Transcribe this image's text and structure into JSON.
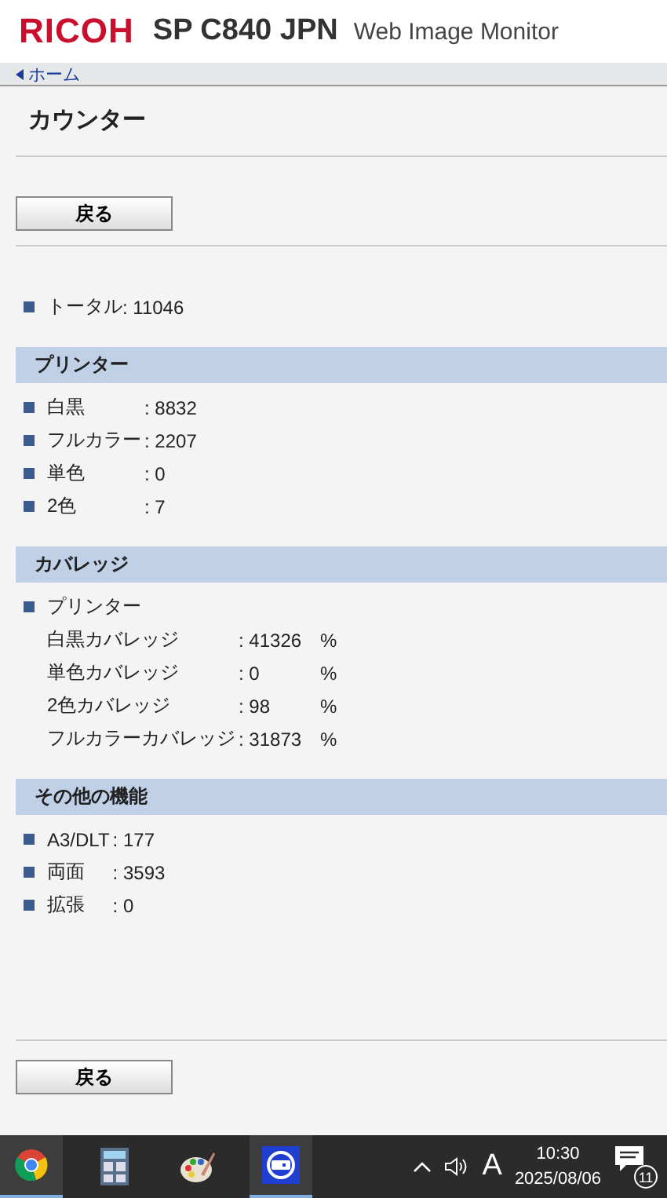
{
  "header": {
    "brand": "RICOH",
    "model": "SP C840 JPN",
    "product": "Web Image Monitor"
  },
  "nav": {
    "breadcrumb": "ホーム"
  },
  "title": "カウンター",
  "top_button": "戻る",
  "total": {
    "label": "トータル",
    "value": ": 11046"
  },
  "sections": [
    {
      "title": "プリンター",
      "items": [
        {
          "kind": "item",
          "label": "白黒",
          "value": ": 8832"
        },
        {
          "kind": "item",
          "label": "フルカラー",
          "value": ": 2207"
        },
        {
          "kind": "item",
          "label": "単色",
          "value": ": 0"
        },
        {
          "kind": "item",
          "label": "2色",
          "value": ": 7"
        }
      ]
    },
    {
      "title": "カバレッジ",
      "items": [
        {
          "kind": "group",
          "label": "プリンター"
        },
        {
          "kind": "sub",
          "label": "白黒カバレッジ",
          "value": ": 41326",
          "unit": "%"
        },
        {
          "kind": "sub",
          "label": "単色カバレッジ",
          "value": ": 0",
          "unit": "%"
        },
        {
          "kind": "sub",
          "label": "2色カバレッジ",
          "value": ": 98",
          "unit": "%"
        },
        {
          "kind": "sub",
          "label": "フルカラーカバレッジ",
          "value": ": 31873",
          "unit": "%"
        }
      ]
    },
    {
      "title": "その他の機能",
      "items": [
        {
          "kind": "item",
          "label": "A3/DLT",
          "value": ": 177"
        },
        {
          "kind": "item",
          "label": "両面",
          "value": ": 3593"
        },
        {
          "kind": "item",
          "label": "拡張",
          "value": ": 0"
        }
      ]
    }
  ],
  "bottom_button": "戻る",
  "taskbar": {
    "apps": [
      {
        "kind": "browser",
        "running": true
      },
      {
        "kind": "calculator",
        "running": false
      },
      {
        "kind": "paint",
        "running": false
      },
      {
        "kind": "remote",
        "running": true
      }
    ],
    "ime": "A",
    "time": "10:30",
    "date": "2025/08/06",
    "notifications": "11"
  }
}
